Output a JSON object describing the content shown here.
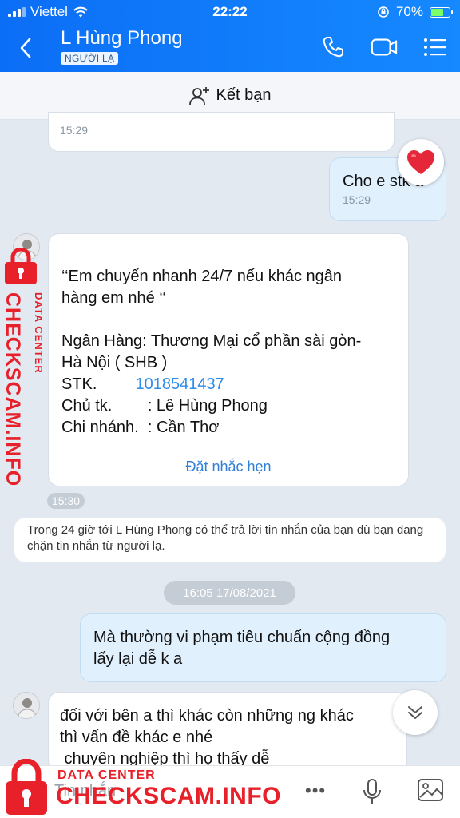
{
  "status_bar": {
    "carrier": "Viettel",
    "time": "22:22",
    "battery": "70%",
    "battery_level": 0.7
  },
  "header": {
    "contact_name": "L Hùng Phong",
    "badge": "NGƯỜI LẠ"
  },
  "icons": {
    "back": "back-arrow-icon",
    "call": "phone-icon",
    "video": "video-icon",
    "menu": "menu-icon",
    "add_friend": "add-user-icon",
    "heart": "heart-icon",
    "scroll_down": "chevron-down-icon",
    "more": "more-dots-icon",
    "mic": "mic-icon",
    "image": "image-icon"
  },
  "add_friend": {
    "label": "Kết bạn"
  },
  "messages": {
    "old_ts": "15:29",
    "stk_request": {
      "text": "Cho e stk a",
      "ts": "15:29"
    },
    "bank": {
      "lines": [
        "‘‘Em chuyển nhanh 24/7 nếu khác ngân",
        "hàng em nhé ‘‘",
        "Ngân Hàng: Thương Mại cổ phần sài gòn-",
        "Hà Nội ( SHB )"
      ],
      "stk_label": "STK.",
      "stk_value": "1018541437",
      "owner": "Chủ tk.        : Lê Hùng Phong",
      "branch": "Chi nhánh.  : Cần Thơ",
      "remind": "Đặt nhắc hẹn",
      "ts": "15:30"
    },
    "notice": "Trong 24 giờ tới L Hùng Phong có thể trả lời tin nhắn của bạn dù bạn đang chặn tin nhắn từ người lạ.",
    "date_divider": "16:05 17/08/2021",
    "rule": {
      "lines": [
        "Mà thường vi phạm tiêu chuẩn cộng đồng",
        "lấy lại dễ k a"
      ]
    },
    "last": {
      "lines": [
        "đối với bên a thì khác còn những ng khác",
        "thì vấn đề khác e nhé",
        " chuyên nghiệp thì họ thấy dễ"
      ]
    }
  },
  "input": {
    "placeholder": "Tin nhắn"
  },
  "watermark": {
    "data_center": "DATA CENTER",
    "brand": "CHECKSCAM.INFO",
    "color": "#e8202a"
  },
  "colors": {
    "header_start": "#0b6ef6",
    "header_end": "#1689ff",
    "chat_bg": "#e2e9f1",
    "my_bubble": "#e1f0fd",
    "link": "#2f8ce8"
  }
}
